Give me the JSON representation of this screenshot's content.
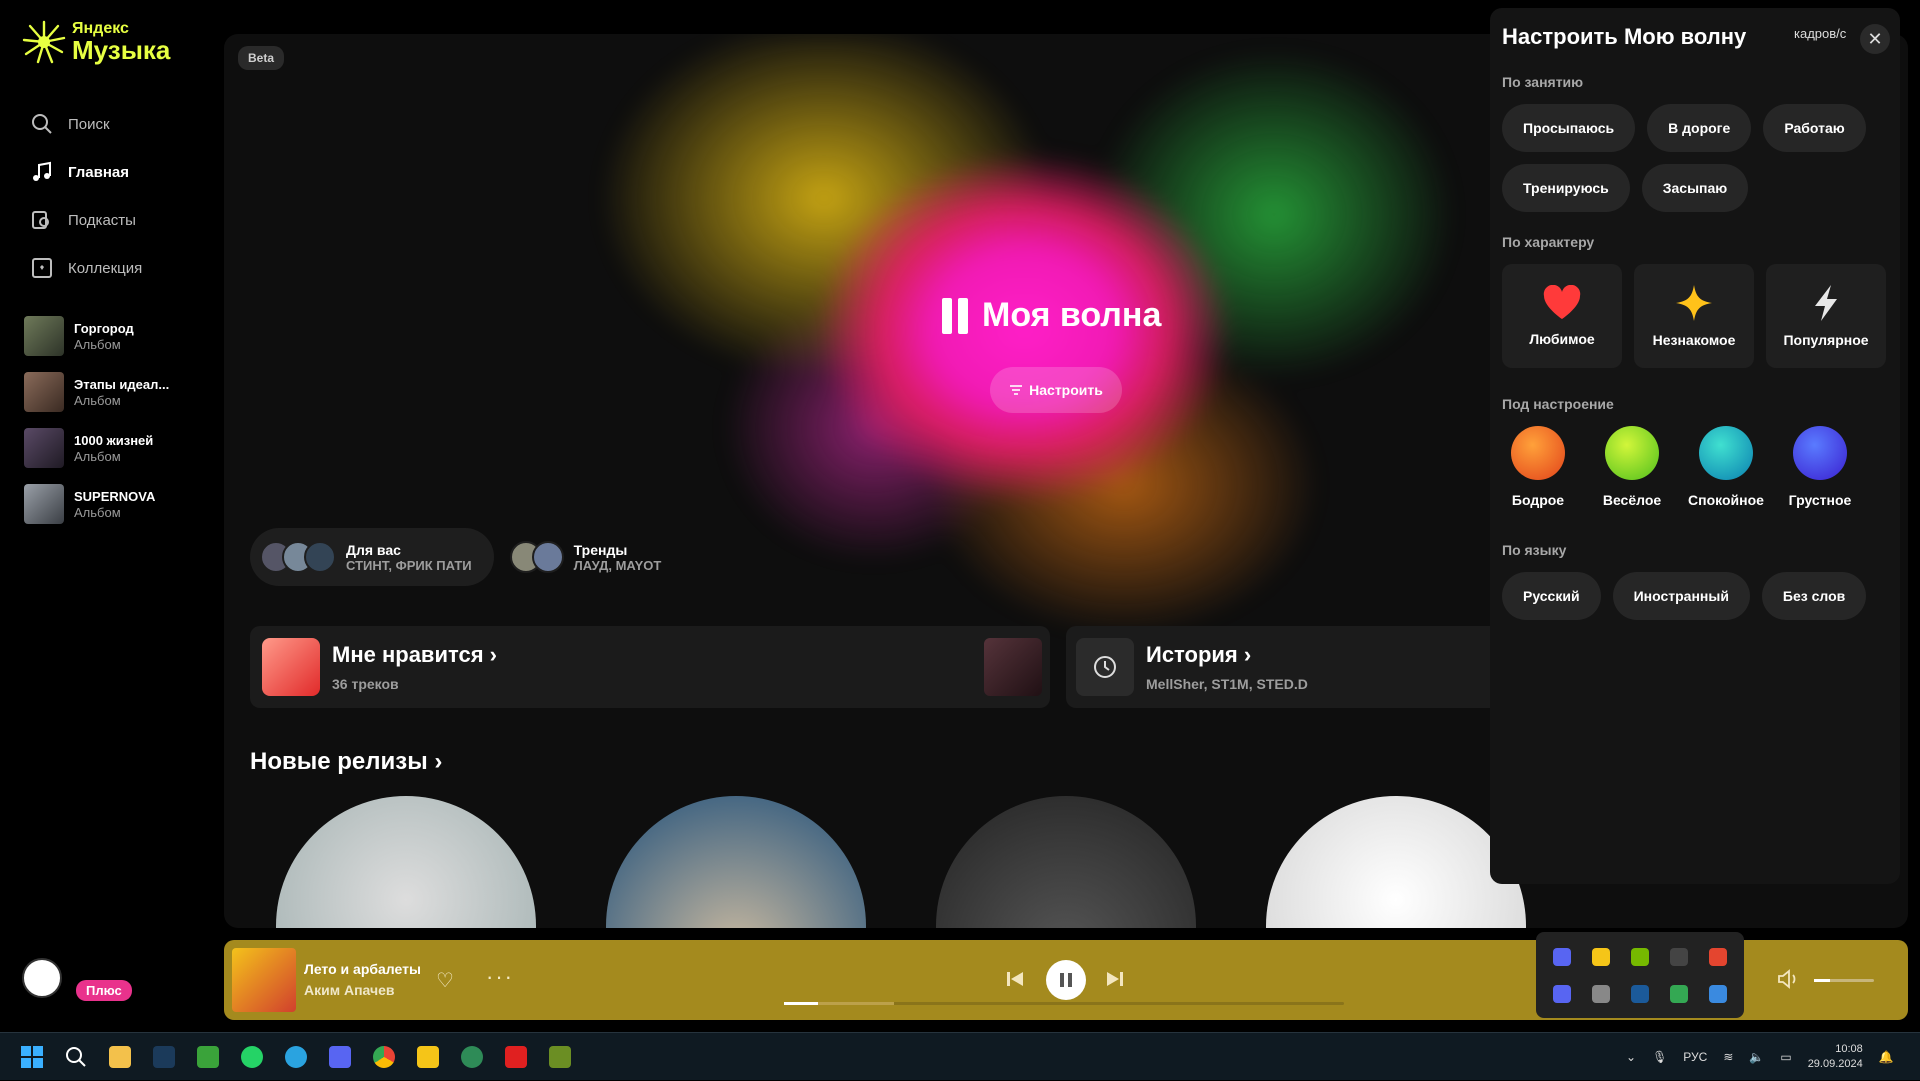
{
  "app": {
    "logo_line1": "Яндекс",
    "logo_line2": "Музыка"
  },
  "nav": [
    {
      "label": "Поиск",
      "icon": "search-icon"
    },
    {
      "label": "Главная",
      "icon": "music-note-icon"
    },
    {
      "label": "Подкасты",
      "icon": "podcast-icon"
    },
    {
      "label": "Коллекция",
      "icon": "collection-icon"
    }
  ],
  "recent": [
    {
      "title": "Горгород",
      "sub": "Альбом"
    },
    {
      "title": "Этапы идеал...",
      "sub": "Альбом"
    },
    {
      "title": "1000 жизней",
      "sub": "Альбом"
    },
    {
      "title": "SUPERNOVA",
      "sub": "Альбом"
    }
  ],
  "main": {
    "beta": "Beta",
    "wave_title": "Моя волна",
    "tune_label": "Настроить",
    "chips": [
      {
        "title": "Для вас",
        "sub": "СТИНТ, ФРИК ПАТИ"
      },
      {
        "title": "Тренды",
        "sub": "ЛАУД, MAYOT"
      }
    ],
    "likes": {
      "title": "Мне нравится",
      "sub": "36 треков"
    },
    "history": {
      "title": "История",
      "sub": "MellSher, ST1M, STED.D"
    },
    "new_releases": "Новые релизы"
  },
  "panel": {
    "title": "Настроить Мою волну",
    "window_extra": "кадров/с",
    "occupation_label": "По занятию",
    "occupation": [
      "Просыпаюсь",
      "В дороге",
      "Работаю",
      "Тренируюсь",
      "Засыпаю"
    ],
    "character_label": "По характеру",
    "character": [
      {
        "label": "Любимое",
        "icon": "heart-icon",
        "color": "#ff3a3a"
      },
      {
        "label": "Незнакомое",
        "icon": "sparkle-icon",
        "color": "#ffc21a"
      },
      {
        "label": "Популярное",
        "icon": "lightning-icon",
        "color": "#e8e8e8"
      }
    ],
    "mood_label": "Под настроение",
    "mood": [
      {
        "label": "Бодрое",
        "color": "#f26a1b"
      },
      {
        "label": "Весёлое",
        "color": "#8fdc25"
      },
      {
        "label": "Спокойное",
        "color": "#17b7c4"
      },
      {
        "label": "Грустное",
        "color": "#3a4cf0"
      }
    ],
    "lang_label": "По языку",
    "lang": [
      "Русский",
      "Иностранный",
      "Без слов"
    ]
  },
  "player": {
    "plus": "Плюс",
    "track": "Лето и арбалеты",
    "artist": "Аким Апачев",
    "progress": 0.06,
    "volume": 0.27
  },
  "taskbar": {
    "lang": "РУС",
    "time": "10:08",
    "date": "29.09.2024"
  },
  "colors": {
    "accent": "#e7ff42",
    "player_bg": "#a48a1e"
  }
}
